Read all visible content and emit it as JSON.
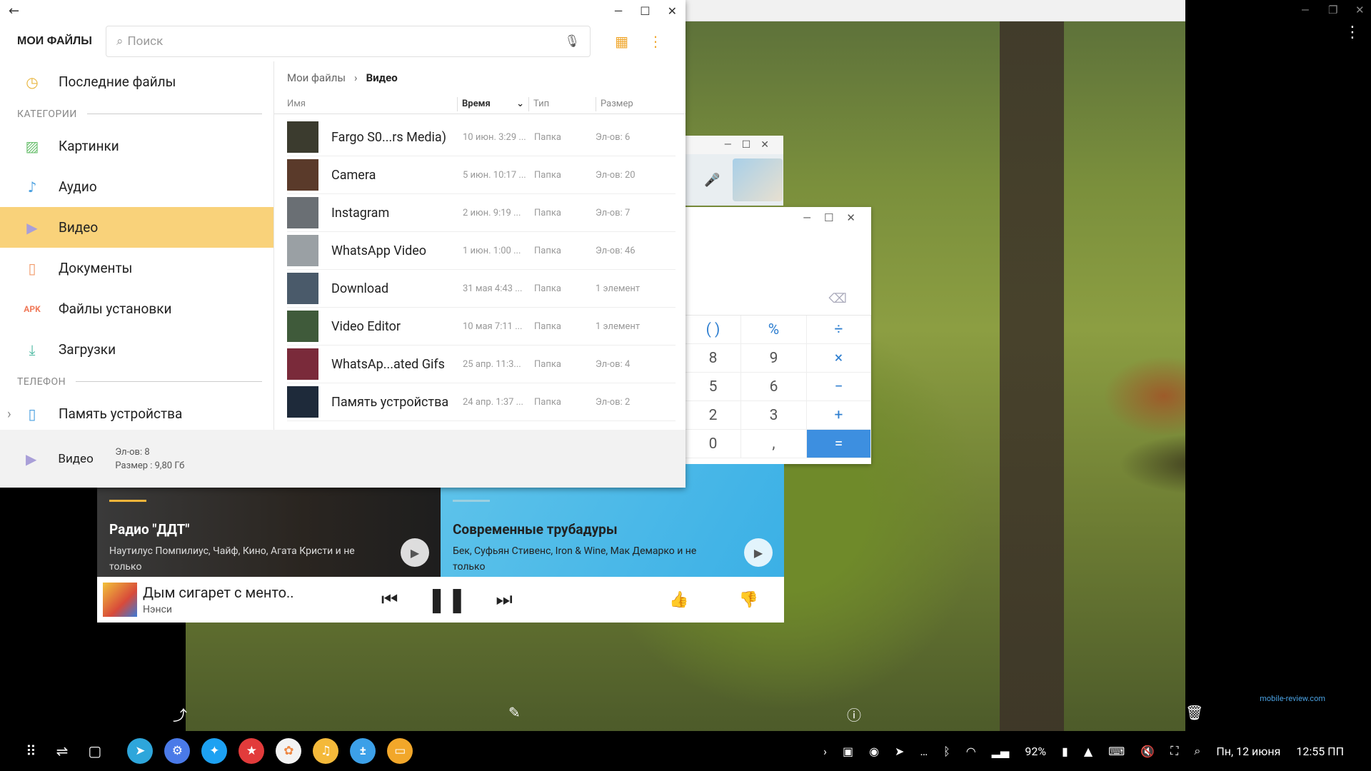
{
  "files_window": {
    "app_title": "МОИ ФАЙЛЫ",
    "search_placeholder": "Поиск",
    "nav": {
      "recent": "Последние файлы",
      "section_categories": "КАТЕГОРИИ",
      "images": "Картинки",
      "audio": "Аудио",
      "video": "Видео",
      "documents": "Документы",
      "apk_badge": "APK",
      "installers": "Файлы установки",
      "downloads": "Загрузки",
      "section_phone": "ТЕЛЕФОН",
      "device_storage": "Память устройства"
    },
    "breadcrumb": {
      "root": "Мои файлы",
      "current": "Видео"
    },
    "columns": {
      "name": "Имя",
      "time": "Время",
      "type": "Тип",
      "size": "Размер"
    },
    "rows": [
      {
        "name": "Fargo S0...rs Media)",
        "time": "10 июн. 3:29 ...",
        "type": "Папка",
        "size": "Эл-ов: 6"
      },
      {
        "name": "Camera",
        "time": "5 июн. 10:17 ...",
        "type": "Папка",
        "size": "Эл-ов: 20"
      },
      {
        "name": "Instagram",
        "time": "2 июн. 9:19 ...",
        "type": "Папка",
        "size": "Эл-ов: 7"
      },
      {
        "name": "WhatsApp Video",
        "time": "1 июн. 1:00 ...",
        "type": "Папка",
        "size": "Эл-ов: 46"
      },
      {
        "name": "Download",
        "time": "31 мая 4:43 ...",
        "type": "Папка",
        "size": "1 элемент"
      },
      {
        "name": "Video Editor",
        "time": "10 мая 7:11 ...",
        "type": "Папка",
        "size": "1 элемент"
      },
      {
        "name": "WhatsAp...ated Gifs",
        "time": "25 апр. 11:3...",
        "type": "Папка",
        "size": "Эл-ов: 4"
      },
      {
        "name": "Память устройства",
        "time": "24 апр. 1:37 ...",
        "type": "Папка",
        "size": "Эл-ов: 2"
      }
    ],
    "footer": {
      "label": "Видео",
      "count": "Эл-ов: 8",
      "size": "Размер : 9,80 Гб"
    }
  },
  "calculator": {
    "keys": [
      {
        "label": "( )",
        "op": true
      },
      {
        "label": "%",
        "op": true
      },
      {
        "label": "÷",
        "op": true
      },
      {
        "label": "8",
        "op": false
      },
      {
        "label": "9",
        "op": false
      },
      {
        "label": "×",
        "op": true
      },
      {
        "label": "5",
        "op": false
      },
      {
        "label": "6",
        "op": false
      },
      {
        "label": "−",
        "op": true
      },
      {
        "label": "2",
        "op": false
      },
      {
        "label": "3",
        "op": false
      },
      {
        "label": "+",
        "op": true
      },
      {
        "label": "0",
        "op": false
      },
      {
        "label": ",",
        "op": false
      },
      {
        "label": "=",
        "op": true
      }
    ]
  },
  "music": {
    "card1": {
      "title": "Радио \"ДДТ\"",
      "desc": "Наутилус Помпилиус, Чайф, Кино, Агата Кристи и не только"
    },
    "card2": {
      "title": "Современные трубадуры",
      "desc": "Бек, Суфьян Стивенс, Iron & Wine, Мак Демарко и не только"
    },
    "player": {
      "song": "Дым сигарет с менто..",
      "artist": "Нэнси"
    }
  },
  "tray": {
    "battery": "92%",
    "date": "Пн, 12 июня",
    "time": "12:55 ПП"
  },
  "watermark": "mobile-review.com",
  "colors": {
    "accent_yellow": "#f9d27a",
    "calc_blue": "#3d8fe0",
    "music_blue": "#3bb0e6"
  }
}
